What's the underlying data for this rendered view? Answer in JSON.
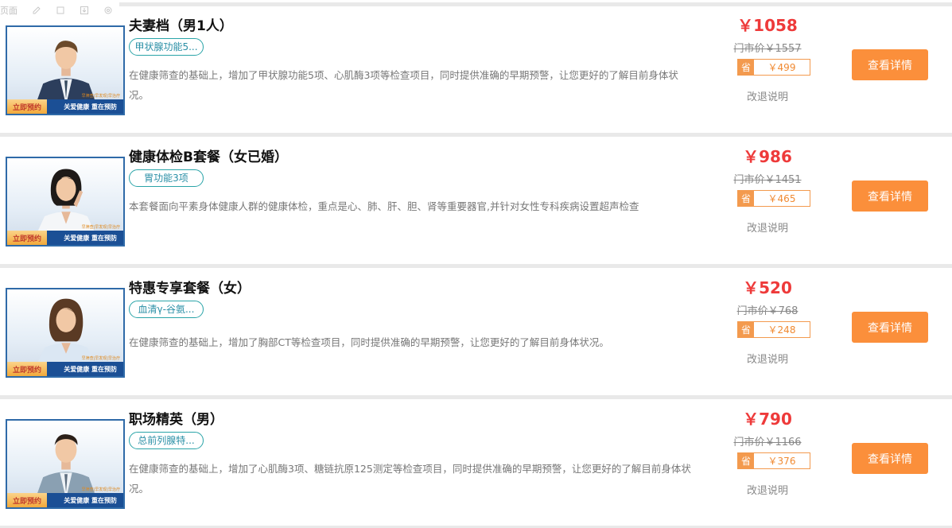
{
  "toolbar": {
    "label": "页面",
    "icons": [
      "edit-icon",
      "crop-icon",
      "download-icon",
      "settings-icon"
    ]
  },
  "badge": {
    "book_label": "立即预约",
    "slogan": "关爱健康  重在预防",
    "tiny_text": "早筛查|早发现|早治疗"
  },
  "colors": {
    "price": "#ee3a3a",
    "button": "#fb8f3b",
    "tag_border": "#2aa4a8",
    "save_border": "#f39a4e"
  },
  "packages": [
    {
      "title": "夫妻档（男1人）",
      "tag": "甲状腺功能5...",
      "desc": "在健康筛查的基础上，增加了甲状腺功能5项、心肌酶3项等检查项目，同时提供准确的早期预警，让您更好的了解目前身体状况。",
      "price": "￥1058",
      "market_price": "门市价￥1557",
      "save_label": "省",
      "save_amount": "￥499",
      "refund": "改退说明",
      "button": "查看详情"
    },
    {
      "title": "健康体检B套餐（女已婚）",
      "tag": "胃功能3项",
      "desc": "本套餐面向平素身体健康人群的健康体检，重点是心、肺、肝、胆、肾等重要器官,并针对女性专科疾病设置超声检查",
      "price": "￥986",
      "market_price": "门市价￥1451",
      "save_label": "省",
      "save_amount": "￥465",
      "refund": "改退说明",
      "button": "查看详情"
    },
    {
      "title": "特惠专享套餐（女）",
      "tag": "血清γ-谷氨...",
      "desc": "在健康筛查的基础上，增加了胸部CT等检查项目，同时提供准确的早期预警，让您更好的了解目前身体状况。",
      "price": "￥520",
      "market_price": "门市价￥768",
      "save_label": "省",
      "save_amount": "￥248",
      "refund": "改退说明",
      "button": "查看详情"
    },
    {
      "title": "职场精英（男）",
      "tag": "总前列腺特...",
      "desc": "在健康筛查的基础上，增加了心肌酶3项、糖链抗原125测定等检查项目，同时提供准确的早期预警，让您更好的了解目前身体状况。",
      "price": "￥790",
      "market_price": "门市价￥1166",
      "save_label": "省",
      "save_amount": "￥376",
      "refund": "改退说明",
      "button": "查看详情"
    }
  ]
}
